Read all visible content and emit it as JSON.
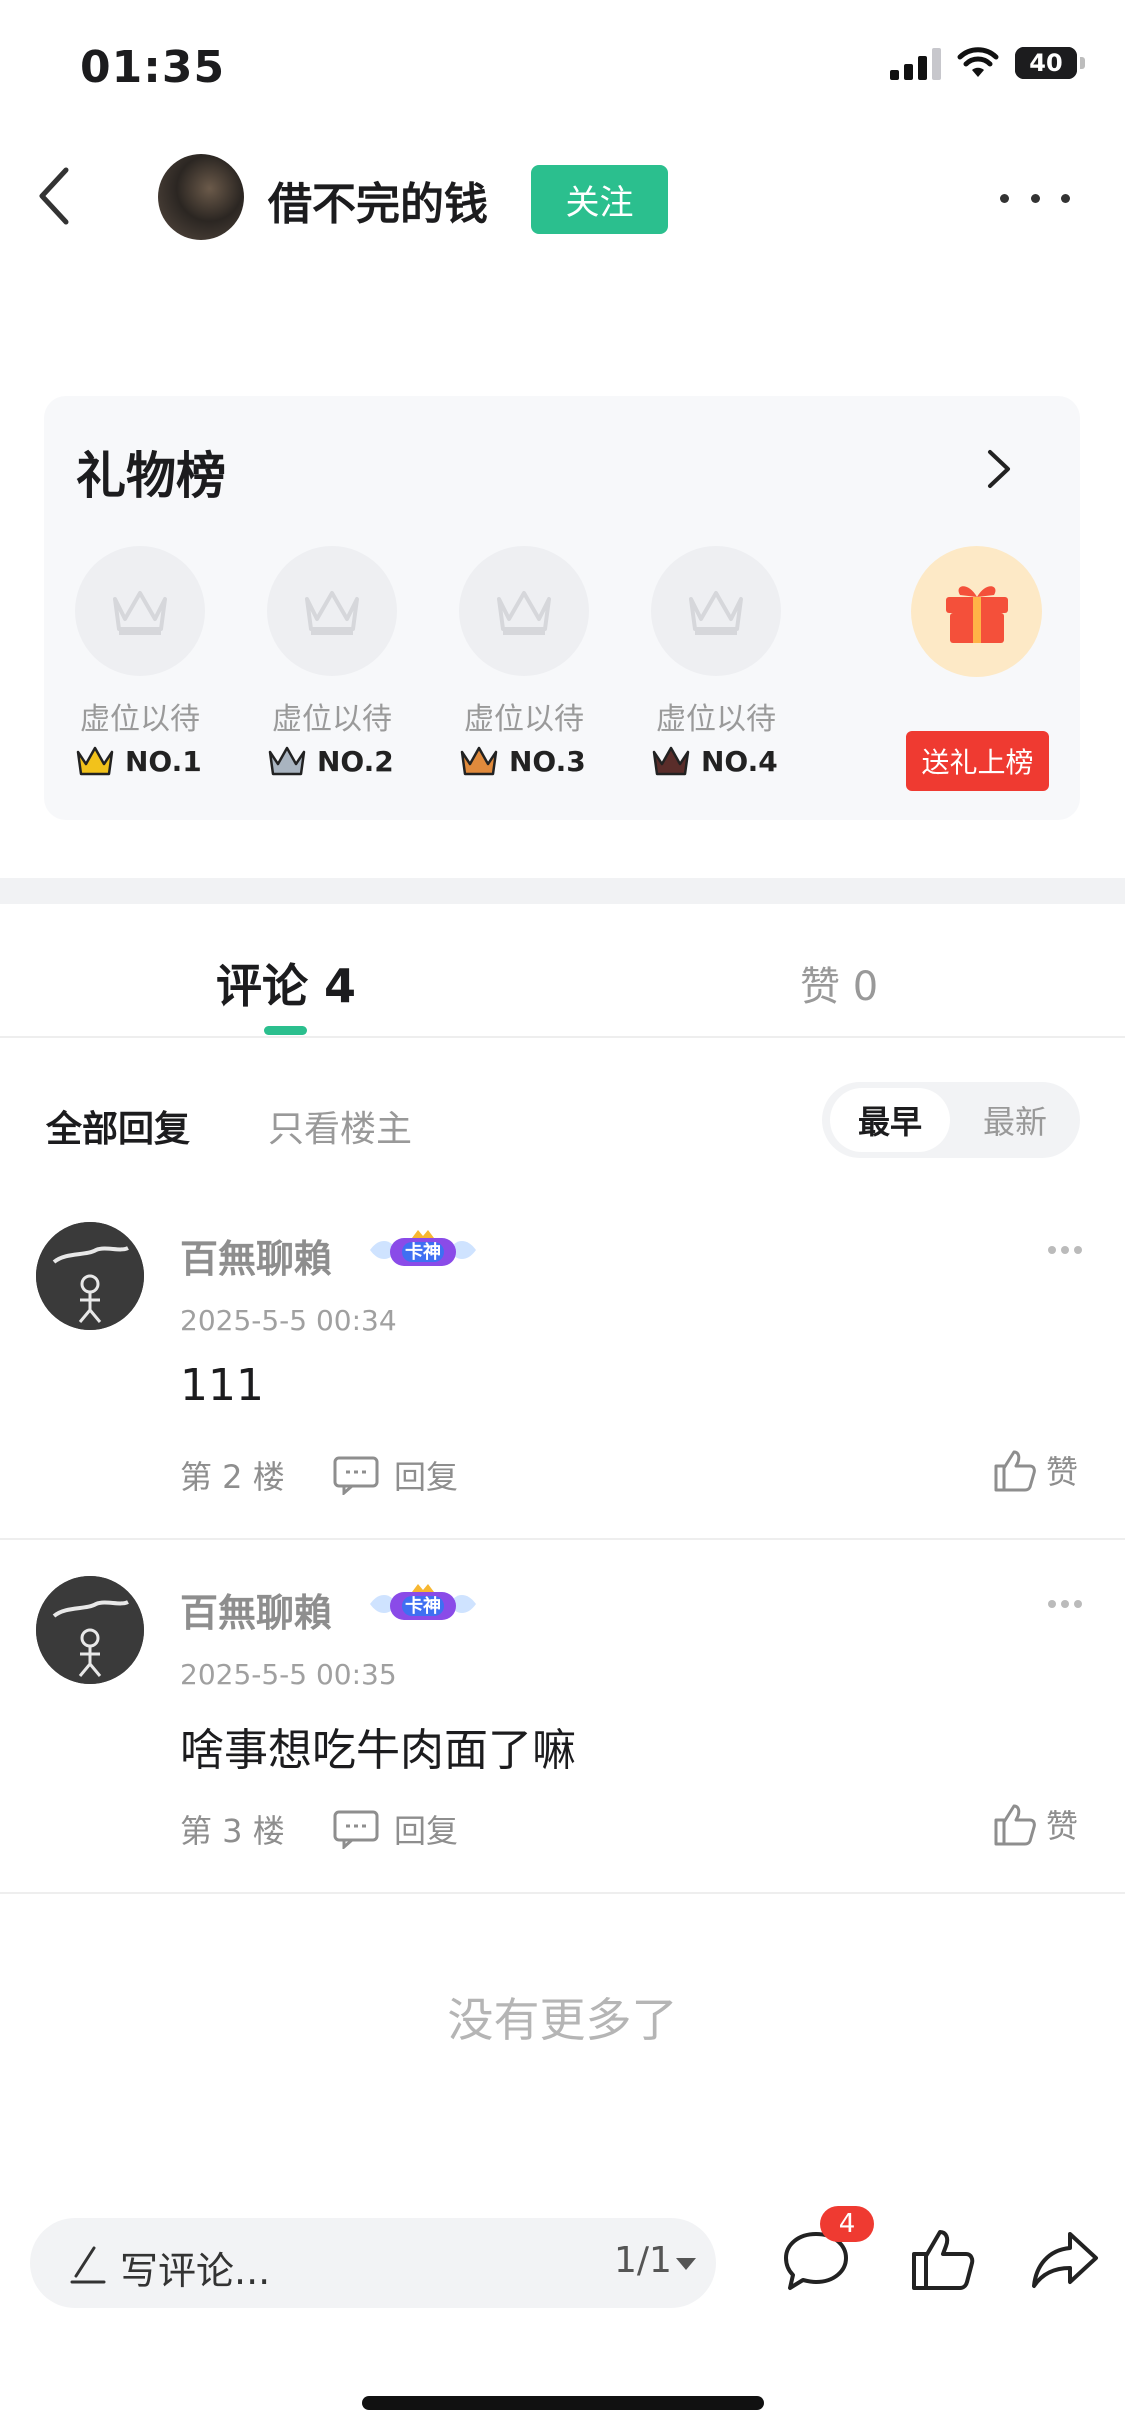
{
  "status_bar": {
    "time": "01:35",
    "battery": "40"
  },
  "header": {
    "author_name": "借不完的钱",
    "follow_label": "关注"
  },
  "gift_board": {
    "title": "礼物榜",
    "slots": [
      {
        "label": "虚位以待",
        "rank": "NO.1",
        "crown_color": "#f2c21b"
      },
      {
        "label": "虚位以待",
        "rank": "NO.2",
        "crown_color": "#a9b4c0"
      },
      {
        "label": "虚位以待",
        "rank": "NO.3",
        "crown_color": "#e08a3c"
      },
      {
        "label": "虚位以待",
        "rank": "NO.4",
        "crown_color": "#5a2d2a"
      }
    ],
    "send_label": "送礼上榜"
  },
  "tabs": {
    "comments": "评论 4",
    "likes": "赞 0"
  },
  "filters": {
    "all": "全部回复",
    "owner_only": "只看楼主",
    "earliest": "最早",
    "latest": "最新"
  },
  "comments": [
    {
      "author": "百無聊賴",
      "badge": "卡神",
      "time": "2025-5-5 00:34",
      "text": "111",
      "floor": "第 2 楼",
      "reply_label": "回复",
      "like_label": "赞"
    },
    {
      "author": "百無聊賴",
      "badge": "卡神",
      "time": "2025-5-5 00:35",
      "text": "啥事想吃牛肉面了嘛",
      "floor": "第 3 楼",
      "reply_label": "回复",
      "like_label": "赞"
    }
  ],
  "no_more": "没有更多了",
  "bottom_bar": {
    "placeholder": "写评论...",
    "page": "1/1",
    "comment_count": "4"
  },
  "colors": {
    "accent": "#2bbf8e",
    "red": "#ef3a31",
    "muted": "#999999"
  }
}
